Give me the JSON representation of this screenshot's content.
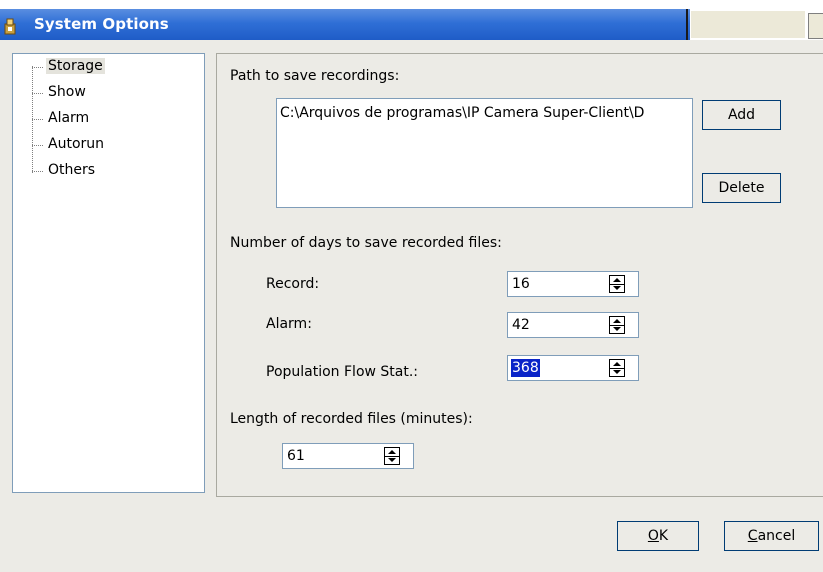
{
  "window": {
    "title": "System Options",
    "icon": "app-icon"
  },
  "tree": {
    "items": [
      {
        "label": "Storage",
        "selected": true
      },
      {
        "label": "Show",
        "selected": false
      },
      {
        "label": "Alarm",
        "selected": false
      },
      {
        "label": "Autorun",
        "selected": false
      },
      {
        "label": "Others",
        "selected": false
      }
    ]
  },
  "storage": {
    "path_label": "Path to save recordings:",
    "path_entry": "C:\\Arquivos de programas\\IP Camera Super-Client\\D",
    "add_label": "Add",
    "delete_label": "Delete",
    "days_label": "Number of days to save recorded files:",
    "record_label": "Record:",
    "record_value": "16",
    "alarm_label": "Alarm:",
    "alarm_value": "42",
    "population_label": "Population Flow Stat.:",
    "population_value": "368",
    "length_label": "Length of recorded files (minutes):",
    "length_value": "61"
  },
  "footer": {
    "ok_label": "OK",
    "ok_mnemonic": "O",
    "ok_rest": "K",
    "cancel_label": "Cancel",
    "cancel_mnemonic": "C",
    "cancel_rest": "ancel"
  },
  "colors": {
    "titlebar": "#2f6fd6",
    "selection_highlight": "#0a24c8",
    "button_border": "#003c74"
  }
}
